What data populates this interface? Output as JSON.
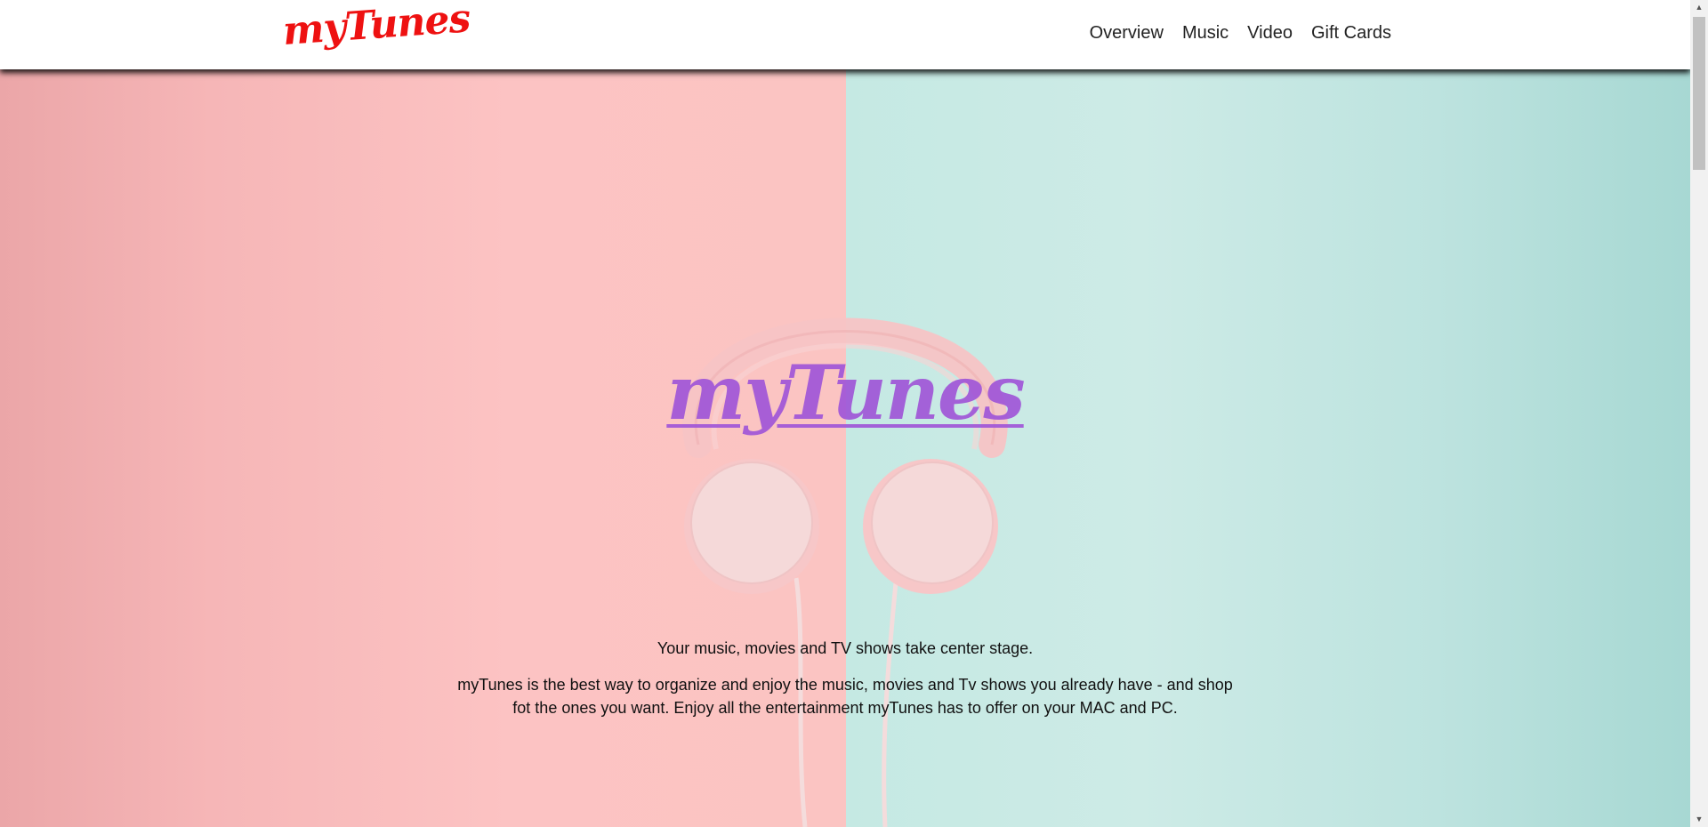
{
  "navbar": {
    "brand": "myTunes",
    "links": [
      {
        "label": "Overview"
      },
      {
        "label": "Music"
      },
      {
        "label": "Video"
      },
      {
        "label": "Gift Cards"
      }
    ]
  },
  "hero": {
    "title": "myTunes",
    "tagline": "Your music, movies and TV shows take center stage.",
    "description": "myTunes is the best way to organize and enjoy the music, movies and Tv shows you already have - and shop fot the ones you want. Enjoy all the entertainment myTunes has to offer on your MAC and PC."
  },
  "colors": {
    "brand": "#ee1111",
    "hero_title": "#a056d8",
    "background_left": "#fbc4c2",
    "background_right": "#c5e9e3"
  },
  "icons": {
    "scroll_up": "triangle-up-icon",
    "scroll_down": "triangle-down-icon",
    "hero_image": "headphones-icon"
  }
}
